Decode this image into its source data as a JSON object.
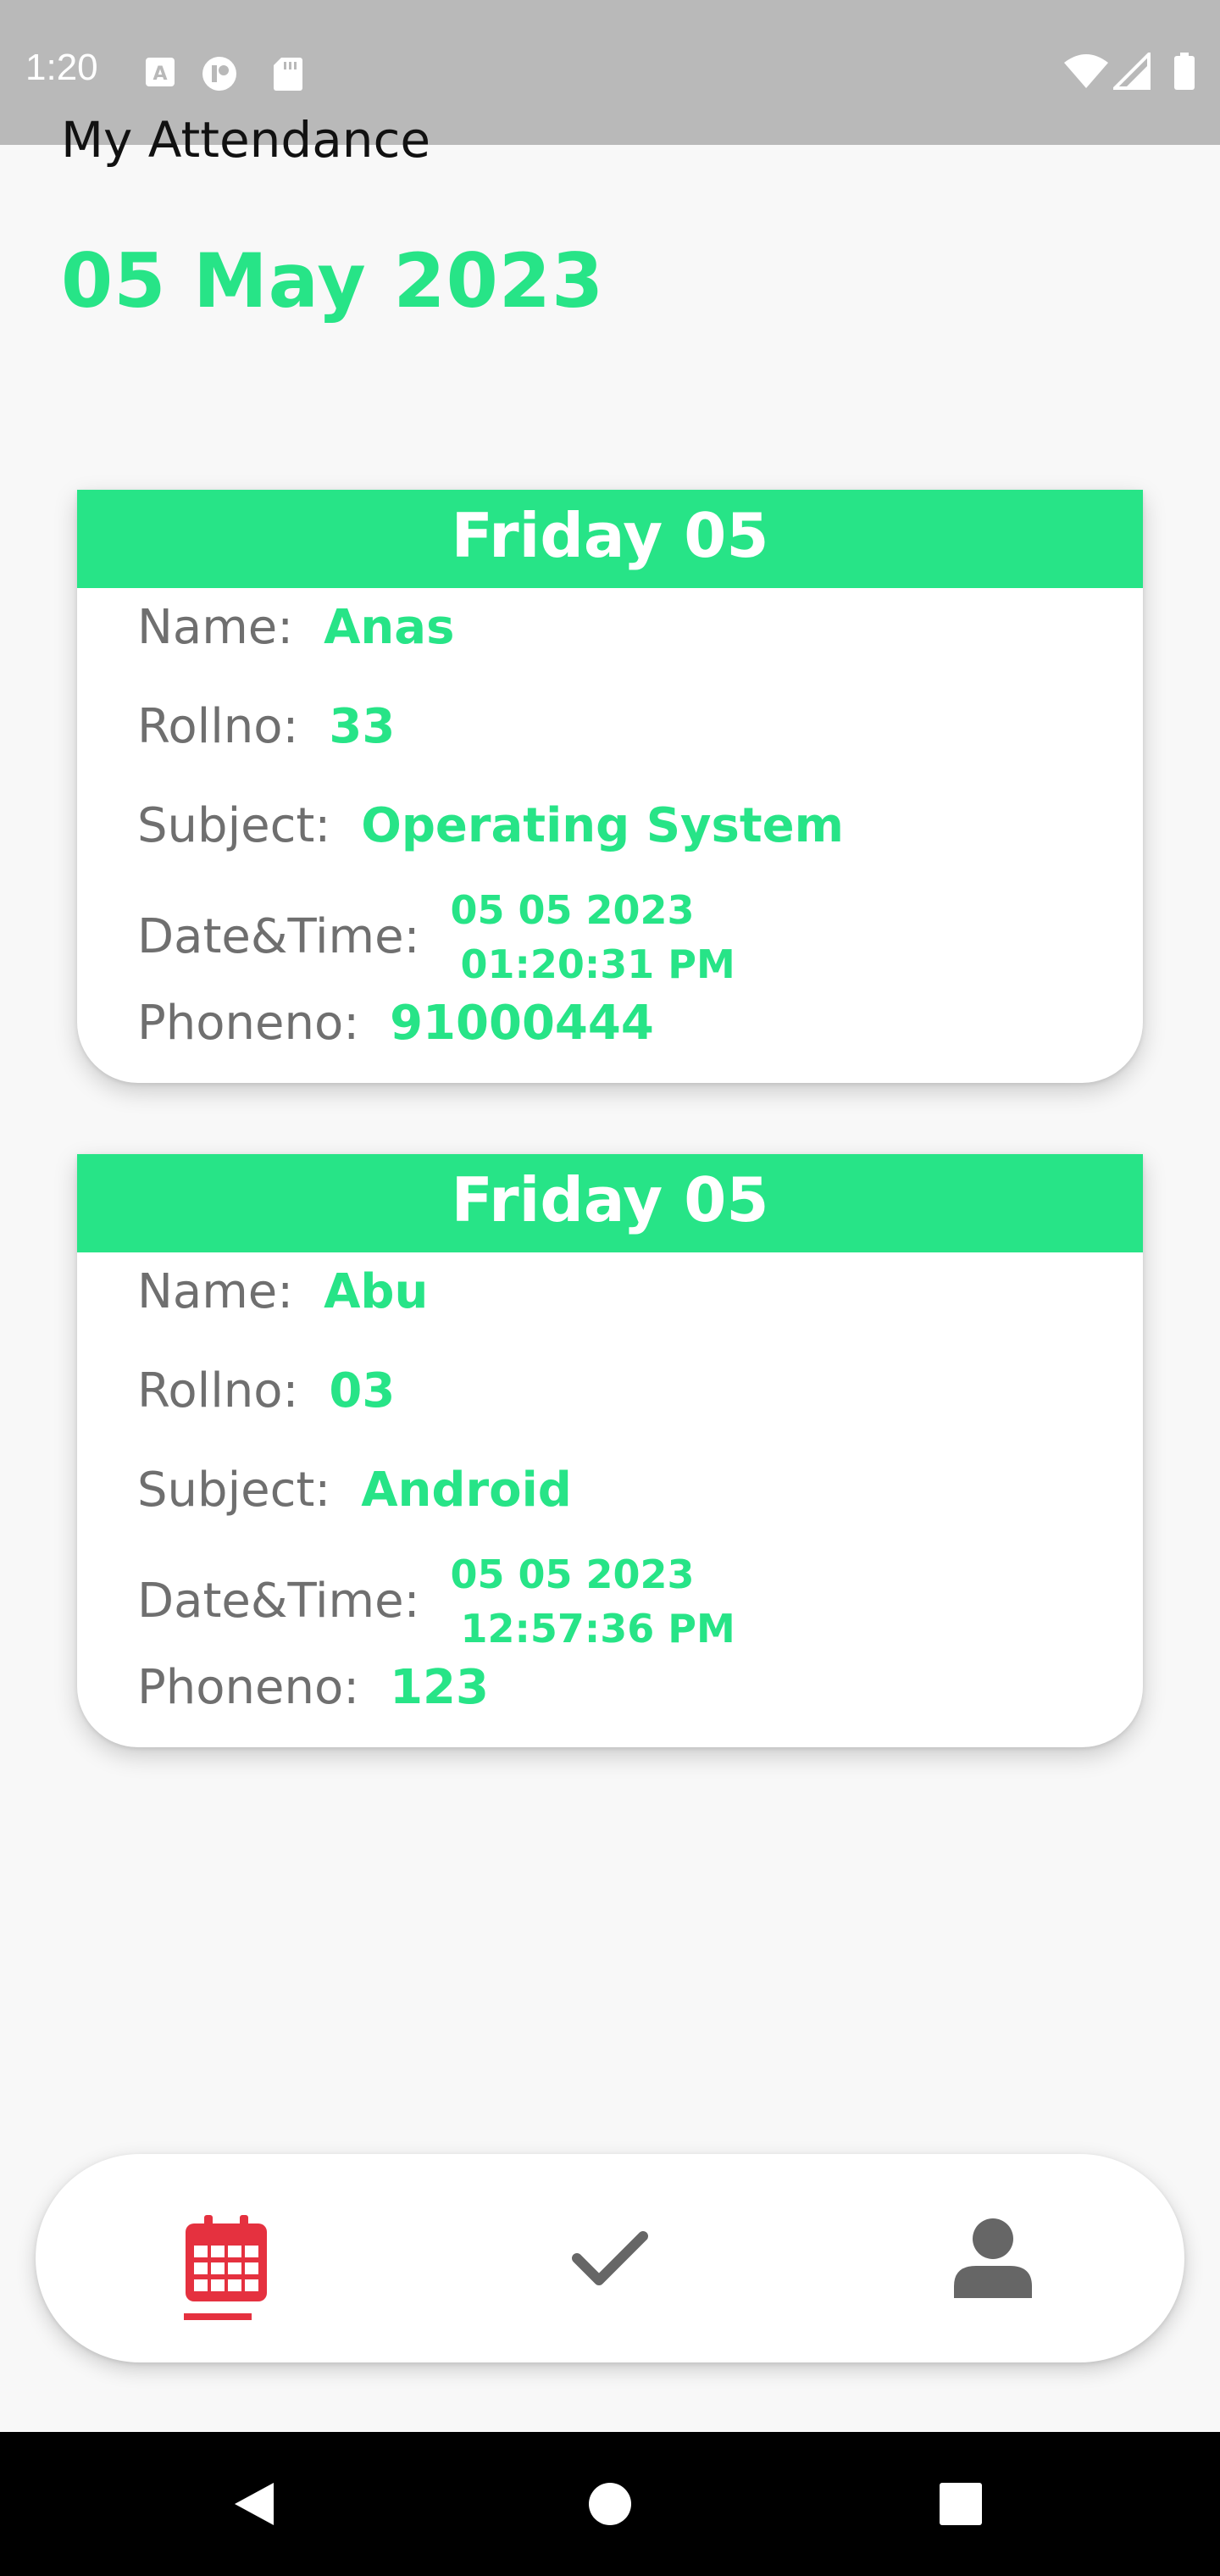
{
  "status_bar": {
    "time": "1:20"
  },
  "header": {
    "title": "My Attendance",
    "date": "05 May 2023"
  },
  "labels": {
    "name": "Name:",
    "rollno": "Rollno:",
    "subject": "Subject:",
    "datetime": "Date&Time:",
    "phone": "Phoneno:"
  },
  "records": [
    {
      "day": "Friday 05",
      "name": "Anas",
      "rollno": "33",
      "subject": "Operating System",
      "date": "05 05 2023",
      "time": "01:20:31 PM",
      "phone": "91000444"
    },
    {
      "day": "Friday 05",
      "name": "Abu",
      "rollno": "03",
      "subject": "Android",
      "date": "05 05 2023",
      "time": "12:57:36 PM",
      "phone": "123"
    }
  ],
  "bottom_nav": {
    "items": [
      {
        "icon": "calendar-icon",
        "active": true
      },
      {
        "icon": "check-icon",
        "active": false
      },
      {
        "icon": "person-icon",
        "active": false
      }
    ]
  },
  "colors": {
    "accent": "#27e487",
    "active_icon": "#e5313f",
    "inactive_icon": "#666666",
    "label": "#6f6f6f",
    "status_bar": "#b9b9b9"
  }
}
